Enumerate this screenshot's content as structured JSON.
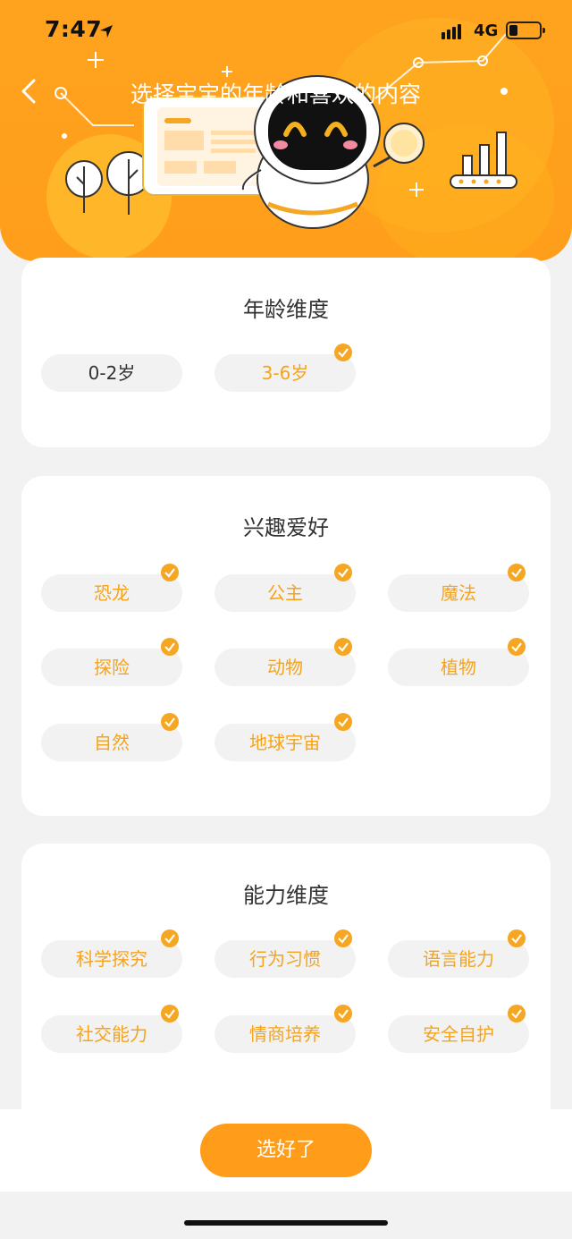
{
  "status_bar": {
    "time": "7:47",
    "network": "4G"
  },
  "header": {
    "title": "选择宝宝的年龄和喜欢的内容"
  },
  "sections": [
    {
      "title": "年龄维度",
      "options": [
        {
          "label": "0-2岁",
          "selected": false
        },
        {
          "label": "3-6岁",
          "selected": true
        }
      ]
    },
    {
      "title": "兴趣爱好",
      "options": [
        {
          "label": "恐龙",
          "selected": true
        },
        {
          "label": "公主",
          "selected": true
        },
        {
          "label": "魔法",
          "selected": true
        },
        {
          "label": "探险",
          "selected": true
        },
        {
          "label": "动物",
          "selected": true
        },
        {
          "label": "植物",
          "selected": true
        },
        {
          "label": "自然",
          "selected": true
        },
        {
          "label": "地球宇宙",
          "selected": true
        }
      ]
    },
    {
      "title": "能力维度",
      "options": [
        {
          "label": "科学探究",
          "selected": true
        },
        {
          "label": "行为习惯",
          "selected": true
        },
        {
          "label": "语言能力",
          "selected": true
        },
        {
          "label": "社交能力",
          "selected": true
        },
        {
          "label": "情商培养",
          "selected": true
        },
        {
          "label": "安全自护",
          "selected": true
        }
      ]
    }
  ],
  "confirm_button": {
    "label": "选好了"
  },
  "colors": {
    "accent": "#f5a31c",
    "header": "#ffa31f",
    "chip_bg": "#f2f2f2"
  },
  "icons": [
    "back-icon",
    "location-arrow-icon",
    "signal-icon",
    "battery-icon",
    "check-icon",
    "robot-mascot-illustration"
  ]
}
